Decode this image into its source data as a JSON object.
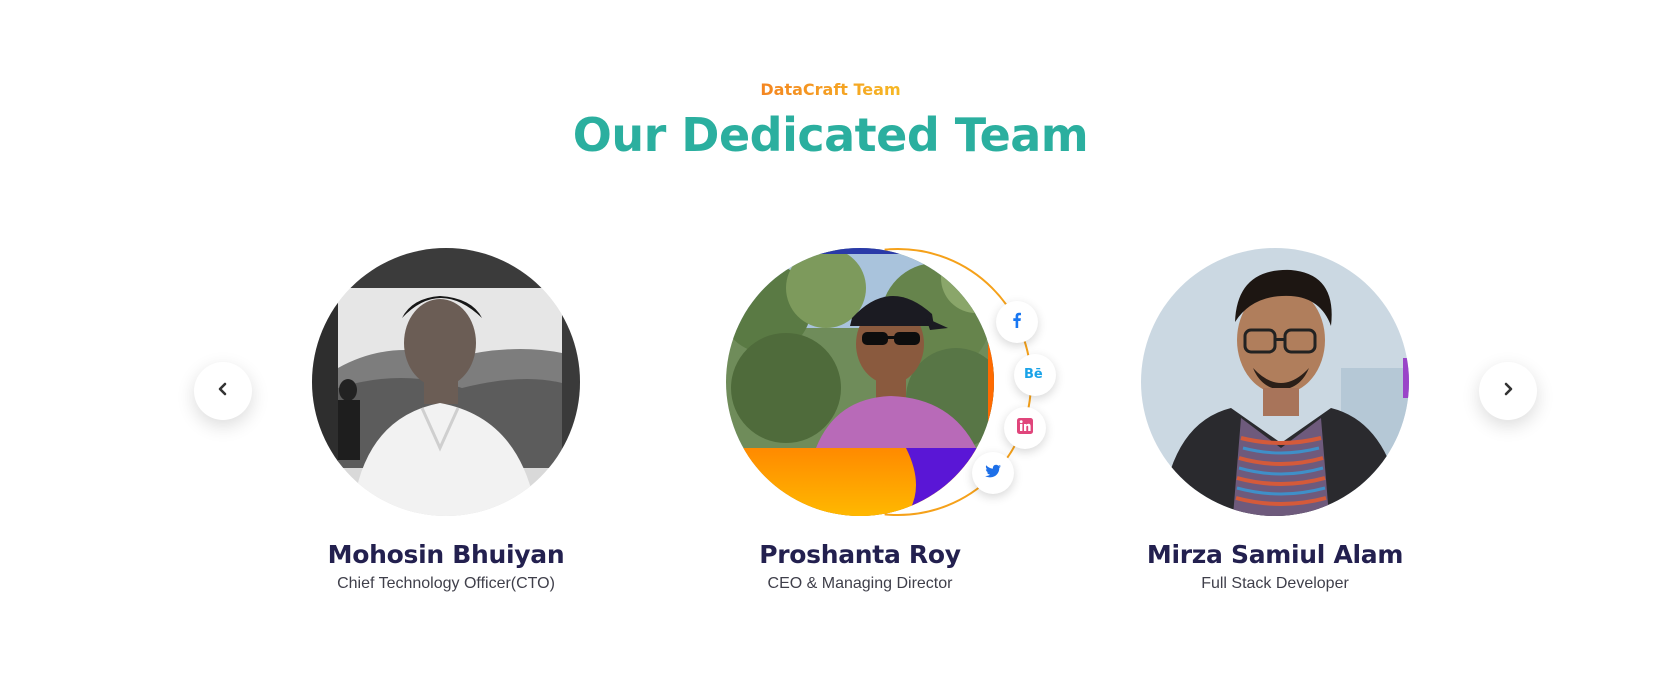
{
  "section": {
    "eyebrow": "DataCraft Team",
    "heading": "Our Dedicated Team"
  },
  "colors": {
    "heading": "#2baf9f",
    "eyebrow_start": "#f47b20",
    "eyebrow_end": "#f7c325",
    "name": "#23204f",
    "ring": "#f5a11a"
  },
  "carousel": {
    "prev_icon": "chevron-left-icon",
    "next_icon": "chevron-right-icon"
  },
  "members": [
    {
      "name": "Mohosin Bhuiyan",
      "role": "Chief Technology Officer(CTO)"
    },
    {
      "name": "Proshanta Roy",
      "role": "CEO & Managing Director",
      "socials": [
        {
          "icon": "facebook-icon",
          "color": "#1877f2"
        },
        {
          "icon": "behance-icon",
          "color": "#1aa3e8"
        },
        {
          "icon": "linkedin-icon",
          "color": "#e0457b"
        },
        {
          "icon": "twitter-icon",
          "color": "#1d6fe8"
        }
      ]
    },
    {
      "name": "Mirza Samiul Alam",
      "role": "Full Stack Developer"
    }
  ]
}
